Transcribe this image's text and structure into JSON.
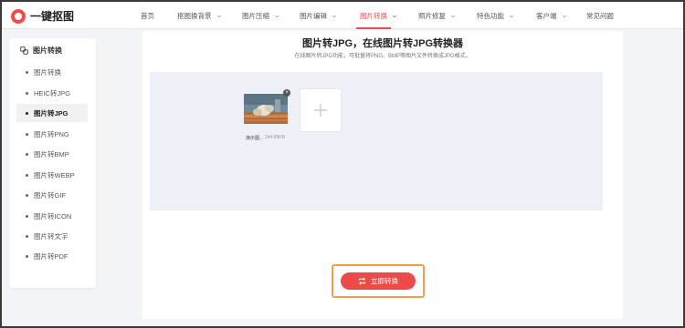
{
  "brand": {
    "name": "一键抠图"
  },
  "nav": {
    "items": [
      {
        "label": "首页",
        "dropdown": false
      },
      {
        "label": "抠图换背景",
        "dropdown": true
      },
      {
        "label": "图片压缩",
        "dropdown": true
      },
      {
        "label": "图片编辑",
        "dropdown": true
      },
      {
        "label": "图片转换",
        "dropdown": true,
        "active": true
      },
      {
        "label": "照片修复",
        "dropdown": true
      },
      {
        "label": "特色功能",
        "dropdown": true
      },
      {
        "label": "客户端",
        "dropdown": true
      },
      {
        "label": "常见问题",
        "dropdown": false
      }
    ]
  },
  "sidebar": {
    "header": "图片转换",
    "items": [
      {
        "label": "图片转换"
      },
      {
        "label": "HEIC转JPG"
      },
      {
        "label": "图片转JPG",
        "active": true
      },
      {
        "label": "图片转PNG"
      },
      {
        "label": "图片转BMP"
      },
      {
        "label": "图片转WEBP"
      },
      {
        "label": "图片转GIF"
      },
      {
        "label": "图片转ICON"
      },
      {
        "label": "图片转文字"
      },
      {
        "label": "图片转PDF"
      }
    ]
  },
  "main": {
    "title": "图片转JPG，在线图片转JPG转换器",
    "subtitle": "在线图片转JPG功能，可批量将PNG、BMP等图片文件转换成JPG格式。",
    "file": {
      "name": "演示图...",
      "size": "344.89KB"
    },
    "convert_label": "立即转换"
  },
  "colors": {
    "accent": "#ef4b4b",
    "highlight": "#f0a040",
    "upload_bg": "#eef0f7"
  }
}
